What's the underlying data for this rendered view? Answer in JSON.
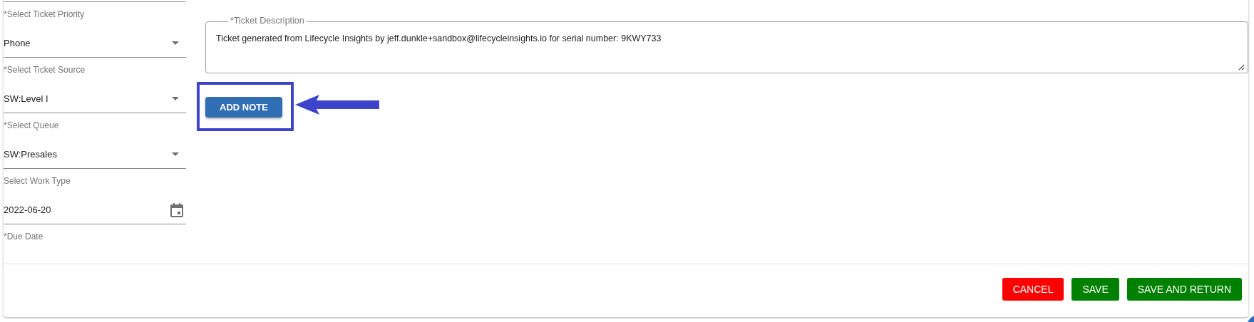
{
  "form": {
    "cut_field_caption": "*Select Ticket Priority",
    "fields": [
      {
        "kind": "select",
        "value": "Phone",
        "caption": "*Select Ticket Source"
      },
      {
        "kind": "select",
        "value": "SW:Level I",
        "caption": "*Select Queue"
      },
      {
        "kind": "select",
        "value": "SW:Presales",
        "caption": "Select Work Type"
      },
      {
        "kind": "date",
        "value": "2022-06-20",
        "caption": "*Due Date"
      }
    ]
  },
  "description": {
    "label": "*Ticket Description",
    "value": "Ticket generated from Lifecycle Insights by jeff.dunkle+sandbox@lifecycleinsights.io for serial number: 9KWY733"
  },
  "add_note": {
    "label": "ADD NOTE",
    "highlighted": true
  },
  "footer_buttons": [
    {
      "label": "CANCEL",
      "kind": "danger"
    },
    {
      "label": "SAVE",
      "kind": "primary"
    },
    {
      "label": "SAVE AND RETURN",
      "kind": "primary"
    }
  ]
}
